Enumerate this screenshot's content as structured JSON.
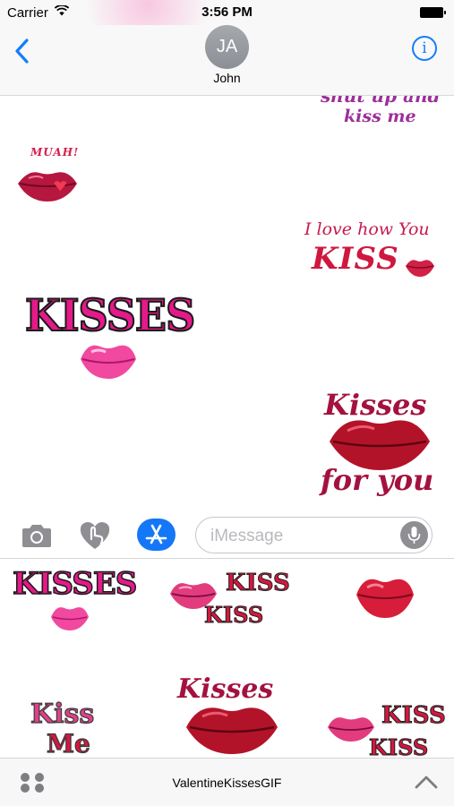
{
  "status_bar": {
    "carrier": "Carrier",
    "time": "3:56 PM"
  },
  "header": {
    "contact_initials": "JA",
    "contact_name": "John"
  },
  "conversation": {
    "stickers": [
      {
        "id": "shut-up",
        "lines": [
          "shut up and",
          "kiss me"
        ]
      },
      {
        "id": "muah",
        "caption": "MUAH!"
      },
      {
        "id": "love-how",
        "lines": [
          "I love how You",
          "KISS"
        ]
      },
      {
        "id": "kisses-big",
        "caption": "KISSES"
      },
      {
        "id": "kisses-for-you",
        "lines": [
          "Kisses",
          "for you"
        ]
      }
    ]
  },
  "compose": {
    "placeholder": "iMessage"
  },
  "drawer": {
    "stickers": [
      {
        "id": "kisses-small",
        "caption": "KISSES"
      },
      {
        "id": "kiss-kiss",
        "lines": [
          "KISS",
          "KISS"
        ]
      },
      {
        "id": "red-lips"
      },
      {
        "id": "kiss-me",
        "lines": [
          "Kiss",
          "Me"
        ]
      },
      {
        "id": "kisses-lips",
        "lines": [
          "Kisses"
        ]
      },
      {
        "id": "kiss-kiss-2",
        "lines": [
          "KISS",
          "KISS"
        ]
      }
    ]
  },
  "app_bar": {
    "app_name": "ValentineKissesGIF"
  },
  "colors": {
    "accent": "#147efb",
    "magenta": "#d61f86",
    "crimson": "#b3123a"
  }
}
